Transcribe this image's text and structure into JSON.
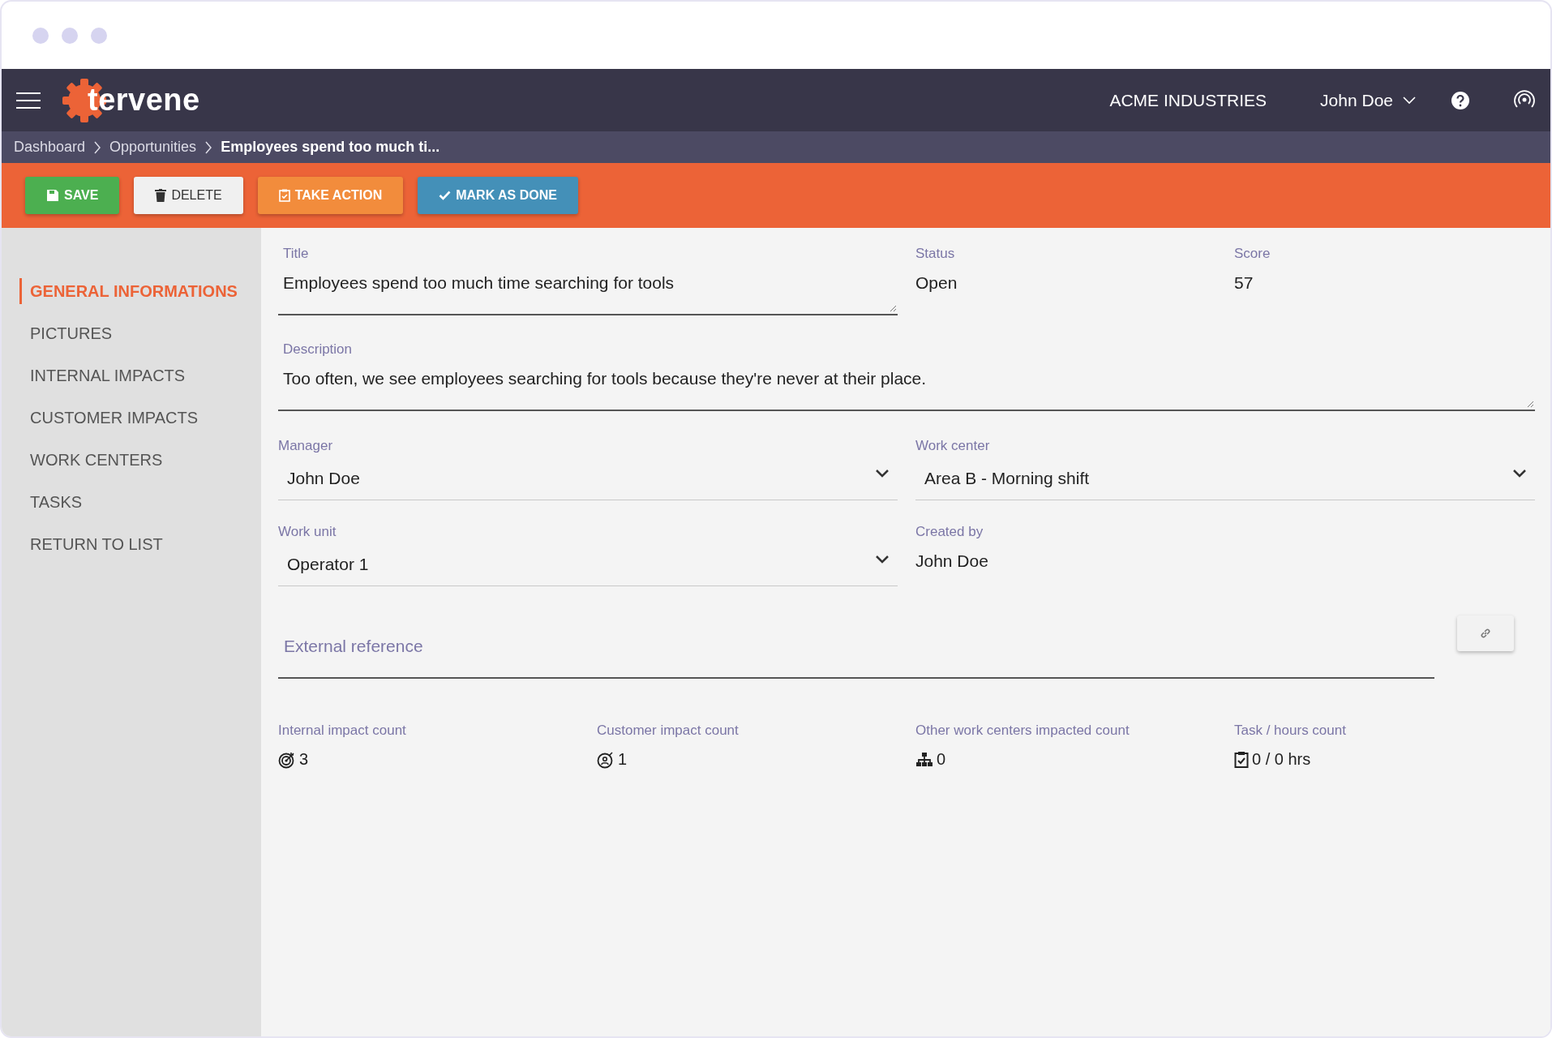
{
  "header": {
    "logo": "tervene",
    "company": "ACME INDUSTRIES",
    "user": "John Doe"
  },
  "breadcrumb": [
    {
      "label": "Dashboard",
      "current": false
    },
    {
      "label": "Opportunities",
      "current": false
    },
    {
      "label": "Employees spend too much ti...",
      "current": true
    }
  ],
  "toolbar": [
    {
      "kind": "save",
      "label": "SAVE"
    },
    {
      "kind": "delete",
      "label": "DELETE"
    },
    {
      "kind": "action",
      "label": "TAKE ACTION"
    },
    {
      "kind": "done",
      "label": "MARK AS DONE"
    }
  ],
  "sidebar": {
    "items": [
      {
        "label": "GENERAL INFORMATIONS",
        "selected": true
      },
      {
        "label": "PICTURES",
        "selected": false
      },
      {
        "label": "INTERNAL IMPACTS",
        "selected": false
      },
      {
        "label": "CUSTOMER IMPACTS",
        "selected": false
      },
      {
        "label": "WORK CENTERS",
        "selected": false
      },
      {
        "label": "TASKS",
        "selected": false
      },
      {
        "label": "RETURN TO LIST",
        "selected": false
      }
    ]
  },
  "form": {
    "fields": [
      {
        "kind": "textarea",
        "label": "Title",
        "value": "Employees spend too much time searching for tools"
      },
      {
        "kind": "readonly",
        "label": "Status",
        "value": "Open"
      },
      {
        "kind": "readonly",
        "label": "Score",
        "value": "57"
      },
      {
        "kind": "textarea",
        "label": "Description",
        "value": "Too often, we see employees searching for tools because they're never at their place."
      },
      {
        "kind": "select",
        "label": "Manager",
        "value": "John Doe"
      },
      {
        "kind": "select",
        "label": "Work center",
        "value": "Area B - Morning shift"
      },
      {
        "kind": "select",
        "label": "Work unit",
        "value": "Operator 1"
      },
      {
        "kind": "readonly",
        "label": "Created by",
        "value": "John Doe"
      },
      {
        "kind": "link",
        "placeholder": "External reference"
      }
    ]
  },
  "stats": [
    {
      "kind": "internal",
      "label": "Internal impact count",
      "value": "3"
    },
    {
      "kind": "customer",
      "label": "Customer impact count",
      "value": "1"
    },
    {
      "kind": "workcenters",
      "label": "Other work centers impacted count",
      "value": "0"
    },
    {
      "kind": "tasks",
      "label": "Task / hours count",
      "value": "0 / 0 hrs"
    }
  ]
}
